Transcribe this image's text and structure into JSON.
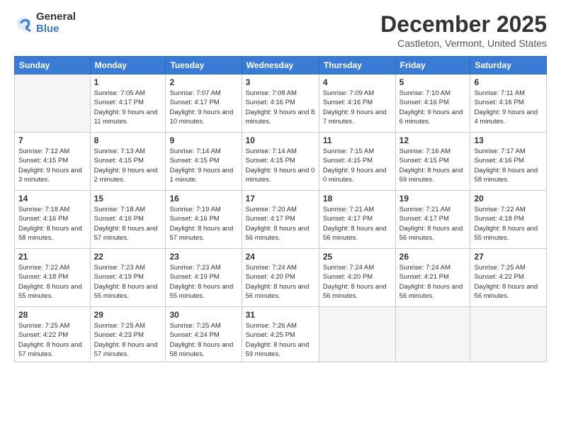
{
  "logo": {
    "general": "General",
    "blue": "Blue"
  },
  "title": "December 2025",
  "subtitle": "Castleton, Vermont, United States",
  "days_header": [
    "Sunday",
    "Monday",
    "Tuesday",
    "Wednesday",
    "Thursday",
    "Friday",
    "Saturday"
  ],
  "weeks": [
    [
      {
        "num": "",
        "empty": true
      },
      {
        "num": "1",
        "sunrise": "Sunrise: 7:05 AM",
        "sunset": "Sunset: 4:17 PM",
        "daylight": "Daylight: 9 hours and 11 minutes."
      },
      {
        "num": "2",
        "sunrise": "Sunrise: 7:07 AM",
        "sunset": "Sunset: 4:17 PM",
        "daylight": "Daylight: 9 hours and 10 minutes."
      },
      {
        "num": "3",
        "sunrise": "Sunrise: 7:08 AM",
        "sunset": "Sunset: 4:16 PM",
        "daylight": "Daylight: 9 hours and 8 minutes."
      },
      {
        "num": "4",
        "sunrise": "Sunrise: 7:09 AM",
        "sunset": "Sunset: 4:16 PM",
        "daylight": "Daylight: 9 hours and 7 minutes."
      },
      {
        "num": "5",
        "sunrise": "Sunrise: 7:10 AM",
        "sunset": "Sunset: 4:16 PM",
        "daylight": "Daylight: 9 hours and 6 minutes."
      },
      {
        "num": "6",
        "sunrise": "Sunrise: 7:11 AM",
        "sunset": "Sunset: 4:16 PM",
        "daylight": "Daylight: 9 hours and 4 minutes."
      }
    ],
    [
      {
        "num": "7",
        "sunrise": "Sunrise: 7:12 AM",
        "sunset": "Sunset: 4:15 PM",
        "daylight": "Daylight: 9 hours and 3 minutes."
      },
      {
        "num": "8",
        "sunrise": "Sunrise: 7:13 AM",
        "sunset": "Sunset: 4:15 PM",
        "daylight": "Daylight: 9 hours and 2 minutes."
      },
      {
        "num": "9",
        "sunrise": "Sunrise: 7:14 AM",
        "sunset": "Sunset: 4:15 PM",
        "daylight": "Daylight: 9 hours and 1 minute."
      },
      {
        "num": "10",
        "sunrise": "Sunrise: 7:14 AM",
        "sunset": "Sunset: 4:15 PM",
        "daylight": "Daylight: 9 hours and 0 minutes."
      },
      {
        "num": "11",
        "sunrise": "Sunrise: 7:15 AM",
        "sunset": "Sunset: 4:15 PM",
        "daylight": "Daylight: 9 hours and 0 minutes."
      },
      {
        "num": "12",
        "sunrise": "Sunrise: 7:16 AM",
        "sunset": "Sunset: 4:15 PM",
        "daylight": "Daylight: 8 hours and 59 minutes."
      },
      {
        "num": "13",
        "sunrise": "Sunrise: 7:17 AM",
        "sunset": "Sunset: 4:16 PM",
        "daylight": "Daylight: 8 hours and 58 minutes."
      }
    ],
    [
      {
        "num": "14",
        "sunrise": "Sunrise: 7:18 AM",
        "sunset": "Sunset: 4:16 PM",
        "daylight": "Daylight: 8 hours and 58 minutes."
      },
      {
        "num": "15",
        "sunrise": "Sunrise: 7:18 AM",
        "sunset": "Sunset: 4:16 PM",
        "daylight": "Daylight: 8 hours and 57 minutes."
      },
      {
        "num": "16",
        "sunrise": "Sunrise: 7:19 AM",
        "sunset": "Sunset: 4:16 PM",
        "daylight": "Daylight: 8 hours and 57 minutes."
      },
      {
        "num": "17",
        "sunrise": "Sunrise: 7:20 AM",
        "sunset": "Sunset: 4:17 PM",
        "daylight": "Daylight: 8 hours and 56 minutes."
      },
      {
        "num": "18",
        "sunrise": "Sunrise: 7:21 AM",
        "sunset": "Sunset: 4:17 PM",
        "daylight": "Daylight: 8 hours and 56 minutes."
      },
      {
        "num": "19",
        "sunrise": "Sunrise: 7:21 AM",
        "sunset": "Sunset: 4:17 PM",
        "daylight": "Daylight: 8 hours and 56 minutes."
      },
      {
        "num": "20",
        "sunrise": "Sunrise: 7:22 AM",
        "sunset": "Sunset: 4:18 PM",
        "daylight": "Daylight: 8 hours and 55 minutes."
      }
    ],
    [
      {
        "num": "21",
        "sunrise": "Sunrise: 7:22 AM",
        "sunset": "Sunset: 4:18 PM",
        "daylight": "Daylight: 8 hours and 55 minutes."
      },
      {
        "num": "22",
        "sunrise": "Sunrise: 7:23 AM",
        "sunset": "Sunset: 4:19 PM",
        "daylight": "Daylight: 8 hours and 55 minutes."
      },
      {
        "num": "23",
        "sunrise": "Sunrise: 7:23 AM",
        "sunset": "Sunset: 4:19 PM",
        "daylight": "Daylight: 8 hours and 55 minutes."
      },
      {
        "num": "24",
        "sunrise": "Sunrise: 7:24 AM",
        "sunset": "Sunset: 4:20 PM",
        "daylight": "Daylight: 8 hours and 56 minutes."
      },
      {
        "num": "25",
        "sunrise": "Sunrise: 7:24 AM",
        "sunset": "Sunset: 4:20 PM",
        "daylight": "Daylight: 8 hours and 56 minutes."
      },
      {
        "num": "26",
        "sunrise": "Sunrise: 7:24 AM",
        "sunset": "Sunset: 4:21 PM",
        "daylight": "Daylight: 8 hours and 56 minutes."
      },
      {
        "num": "27",
        "sunrise": "Sunrise: 7:25 AM",
        "sunset": "Sunset: 4:22 PM",
        "daylight": "Daylight: 8 hours and 56 minutes."
      }
    ],
    [
      {
        "num": "28",
        "sunrise": "Sunrise: 7:25 AM",
        "sunset": "Sunset: 4:22 PM",
        "daylight": "Daylight: 8 hours and 57 minutes."
      },
      {
        "num": "29",
        "sunrise": "Sunrise: 7:25 AM",
        "sunset": "Sunset: 4:23 PM",
        "daylight": "Daylight: 8 hours and 57 minutes."
      },
      {
        "num": "30",
        "sunrise": "Sunrise: 7:25 AM",
        "sunset": "Sunset: 4:24 PM",
        "daylight": "Daylight: 8 hours and 58 minutes."
      },
      {
        "num": "31",
        "sunrise": "Sunrise: 7:26 AM",
        "sunset": "Sunset: 4:25 PM",
        "daylight": "Daylight: 8 hours and 59 minutes."
      },
      {
        "num": "",
        "empty": true
      },
      {
        "num": "",
        "empty": true
      },
      {
        "num": "",
        "empty": true
      }
    ]
  ]
}
